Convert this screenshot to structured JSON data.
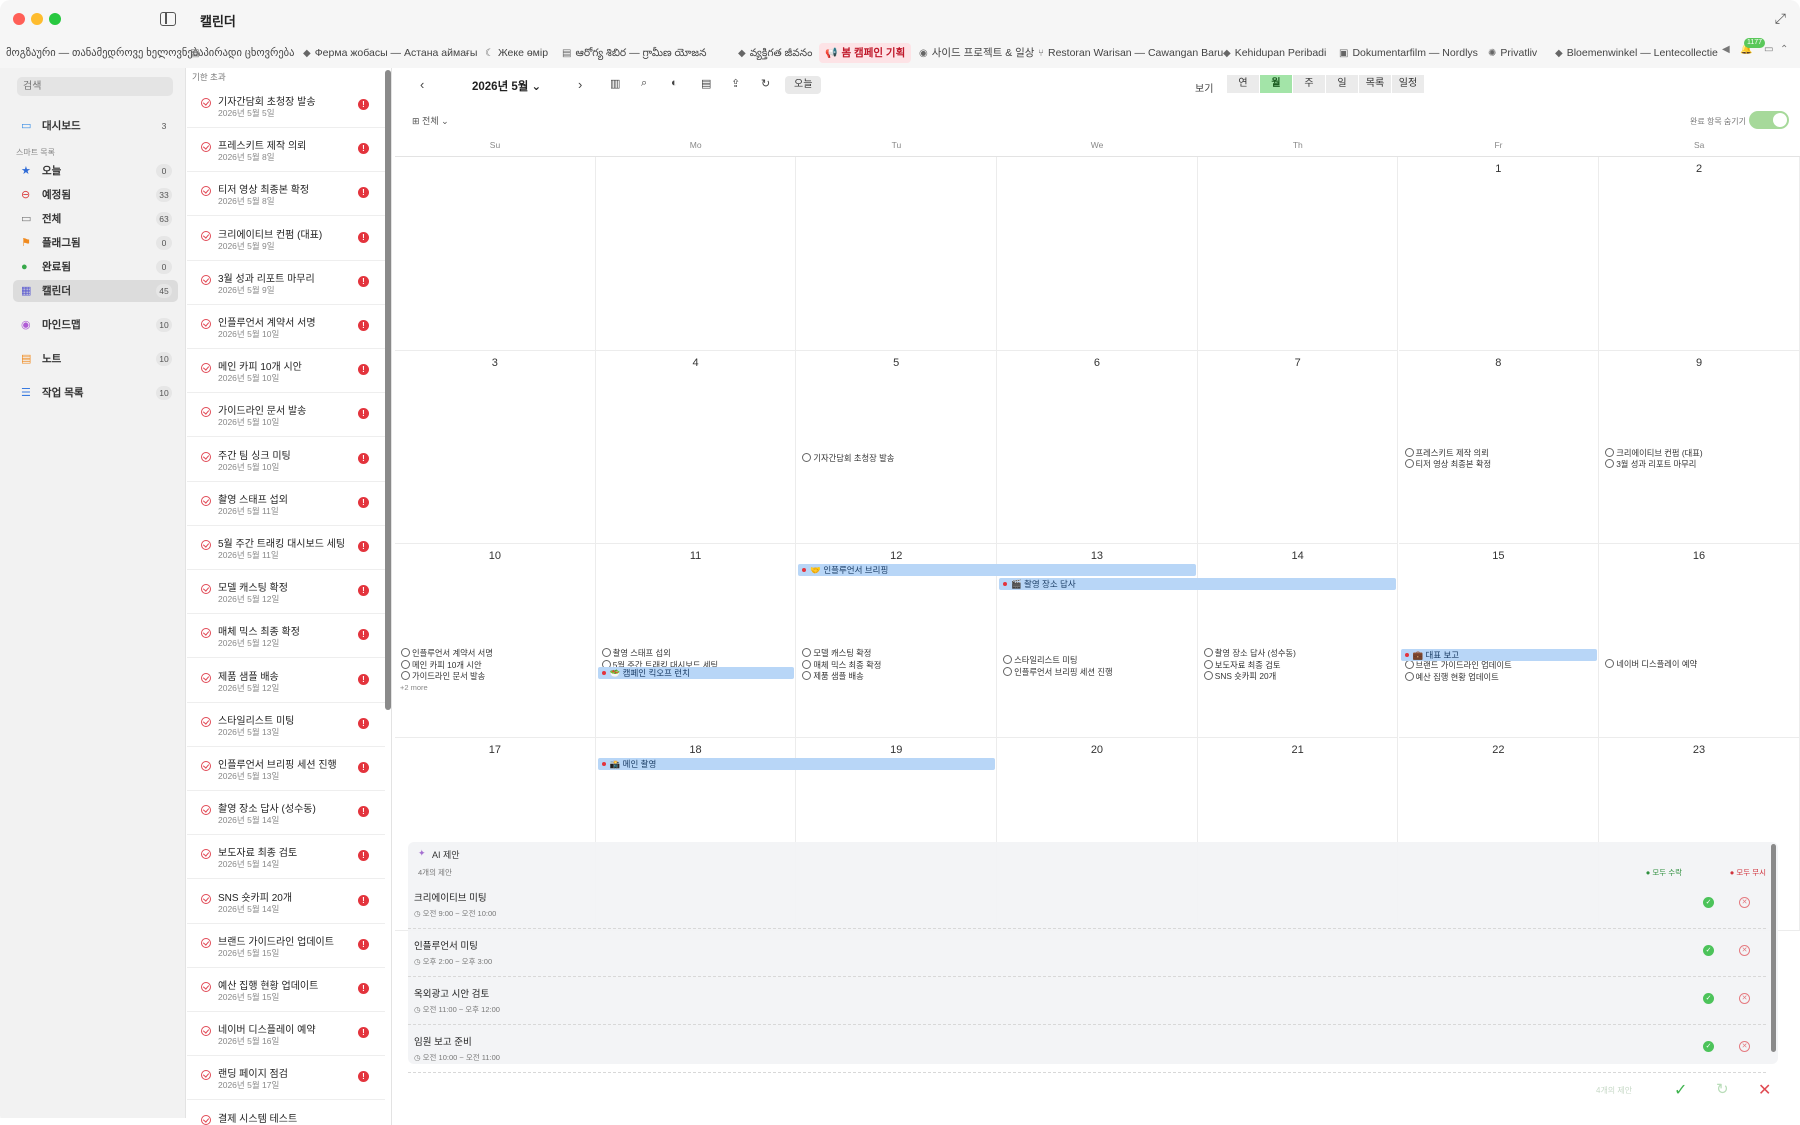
{
  "window": {
    "title": "캘린더"
  },
  "tabs": [
    {
      "label": "მოგზაური — თანამედროვე ხელოვნება",
      "icon": ""
    },
    {
      "label": "პირადი ცხოვრება",
      "icon": "doc-icon"
    },
    {
      "label": "Ферма жобасы — Астана аймағы",
      "icon": "tag-icon"
    },
    {
      "label": "Жеке өмір",
      "icon": "moon-icon"
    },
    {
      "label": "ఆరోగ్య శిబిర — గ్రామీణ యోజన",
      "icon": "doc-icon"
    },
    {
      "label": "వ్యక్తిగత జీవనం",
      "icon": "tag-icon"
    },
    {
      "label": "봄 캠페인 기획",
      "icon": "megaphone-icon"
    },
    {
      "label": "사이드 프로젝트 & 일상",
      "icon": "circle-icon"
    },
    {
      "label": "Restoran Warisan — Cawangan Baru",
      "icon": "fork-icon"
    },
    {
      "label": "Kehidupan Peribadi",
      "icon": "tag-icon"
    },
    {
      "label": "Dokumentarfilm — Nordlys",
      "icon": "camera-icon"
    },
    {
      "label": "Privatliv",
      "icon": "sun-icon"
    },
    {
      "label": "Bloemenwinkel — Lentecollectie",
      "icon": "tag-icon"
    }
  ],
  "tab_controls": {
    "badge": "1177"
  },
  "sidebar": {
    "search_placeholder": "검색",
    "dashboard": {
      "label": "대시보드",
      "count": "3"
    },
    "smart_list_title": "스마트 목록",
    "items": [
      {
        "label": "오늘",
        "count": "0"
      },
      {
        "label": "예정됨",
        "count": "33"
      },
      {
        "label": "전체",
        "count": "63"
      },
      {
        "label": "플래그됨",
        "count": "0"
      },
      {
        "label": "완료됨",
        "count": "0"
      },
      {
        "label": "캘린더",
        "count": "45"
      }
    ],
    "extra": [
      {
        "label": "마인드맵",
        "count": "10"
      },
      {
        "label": "노트",
        "count": "10"
      },
      {
        "label": "작업 목록",
        "count": "10"
      }
    ]
  },
  "tasklist": {
    "header": "기한 초과",
    "items": [
      {
        "title": "기자간담회 초청장 발송",
        "date": "2026년 5월 5일"
      },
      {
        "title": "프레스키트 제작 의뢰",
        "date": "2026년 5월 8일"
      },
      {
        "title": "티저 영상 최종본 확정",
        "date": "2026년 5월 8일"
      },
      {
        "title": "크리에이티브 컨펌 (대표)",
        "date": "2026년 5월 9일"
      },
      {
        "title": "3월 성과 리포트 마무리",
        "date": "2026년 5월 9일"
      },
      {
        "title": "인플루언서 계약서 서명",
        "date": "2026년 5월 10일"
      },
      {
        "title": "메인 카피 10개 시안",
        "date": "2026년 5월 10일"
      },
      {
        "title": "가이드라인 문서 발송",
        "date": "2026년 5월 10일"
      },
      {
        "title": "주간 팀 싱크 미팅",
        "date": "2026년 5월 10일"
      },
      {
        "title": "촬영 스태프 섭외",
        "date": "2026년 5월 11일"
      },
      {
        "title": "5월 주간 트래킹 대시보드 세팅",
        "date": "2026년 5월 11일"
      },
      {
        "title": "모델 캐스팅 확정",
        "date": "2026년 5월 12일"
      },
      {
        "title": "매체 믹스 최종 확정",
        "date": "2026년 5월 12일"
      },
      {
        "title": "제품 샘플 배송",
        "date": "2026년 5월 12일"
      },
      {
        "title": "스타일리스트 미팅",
        "date": "2026년 5월 13일"
      },
      {
        "title": "인플루언서 브리핑 세션 진행",
        "date": "2026년 5월 13일"
      },
      {
        "title": "촬영 장소 답사 (성수동)",
        "date": "2026년 5월 14일"
      },
      {
        "title": "보도자료 최종 검토",
        "date": "2026년 5월 14일"
      },
      {
        "title": "SNS 숏카피 20개",
        "date": "2026년 5월 14일"
      },
      {
        "title": "브랜드 가이드라인 업데이트",
        "date": "2026년 5월 15일"
      },
      {
        "title": "예산 집행 현황 업데이트",
        "date": "2026년 5월 15일"
      },
      {
        "title": "네이버 디스플레이 예약",
        "date": "2026년 5월 16일"
      },
      {
        "title": "랜딩 페이지 점검",
        "date": "2026년 5월 17일"
      },
      {
        "title": "결제 시스템 테스트",
        "date": ""
      }
    ],
    "flag": "!"
  },
  "calendar": {
    "month_title": "2026년 5월",
    "today": "오늘",
    "view_label": "보기",
    "views": [
      "연",
      "월",
      "주",
      "일",
      "목록",
      "일정"
    ],
    "active_view": "월",
    "filter": "전체",
    "hide_done": "완료 항목 숨기기",
    "weekdays": [
      "Su",
      "Mo",
      "Tu",
      "We",
      "Th",
      "Fr",
      "Sa"
    ],
    "weeks": [
      [
        {
          "d": ""
        },
        {
          "d": ""
        },
        {
          "d": ""
        },
        {
          "d": ""
        },
        {
          "d": ""
        },
        {
          "d": "1"
        },
        {
          "d": "2"
        }
      ],
      [
        {
          "d": "3"
        },
        {
          "d": "4"
        },
        {
          "d": "5",
          "ev": [
            "기자간담회 초청장 발송"
          ]
        },
        {
          "d": "6"
        },
        {
          "d": "7"
        },
        {
          "d": "8",
          "ev": [
            "프레스키트 제작 의뢰",
            "티저 영상 최종본 확정"
          ]
        },
        {
          "d": "9",
          "ev": [
            "크리에이티브 컨펌 (대표)",
            "3월 성과 리포트 마무리"
          ]
        }
      ],
      [
        {
          "d": "10",
          "ev": [
            "인플루언서 계약서 서명",
            "메인 카피 10개 시안",
            "가이드라인 문서 발송"
          ],
          "more": "+2 more"
        },
        {
          "d": "11",
          "ev": [
            "촬영 스태프 섭외",
            "5월 주간 트래킹 대시보드 세팅"
          ]
        },
        {
          "d": "12",
          "ev": [
            "모델 캐스팅 확정",
            "매체 믹스 최종 확정",
            "제품 샘플 배송"
          ]
        },
        {
          "d": "13",
          "ev": [
            "스타일리스트 미팅",
            "인플루언서 브리핑 세션 진행"
          ]
        },
        {
          "d": "14",
          "ev": [
            "촬영 장소 답사 (성수동)",
            "보도자료 최종 검토",
            "SNS 숏카피 20개"
          ]
        },
        {
          "d": "15",
          "ev": [
            "브랜드 가이드라인 업데이트",
            "예산 집행 현황 업데이트"
          ]
        },
        {
          "d": "16",
          "ev": [
            "네이버 디스플레이 예약"
          ]
        }
      ],
      [
        {
          "d": "17"
        },
        {
          "d": "18"
        },
        {
          "d": "19"
        },
        {
          "d": "20"
        },
        {
          "d": "21"
        },
        {
          "d": "22"
        },
        {
          "d": "23"
        }
      ]
    ],
    "bars": {
      "influencer_briefing": "🤝 인플루언서 브리핑",
      "location_scout": "🎬 촬영 장소 답사",
      "kickoff_lunch": "🥗 캠페인 킥오프 런치",
      "ceo_report": "💼 대표 보고",
      "main_shoot": "📸 메인 촬영"
    }
  },
  "ai_panel": {
    "title": "AI 제안",
    "subtitle": "4개의 제안",
    "accept_all": "모두 수락",
    "ignore_all": "모두 무시",
    "suggestions": [
      {
        "title": "크리에이티브 미팅",
        "time": "오전 9:00 ~ 오전 10:00"
      },
      {
        "title": "인플루언서 미팅",
        "time": "오후 2:00 ~ 오후 3:00"
      },
      {
        "title": "옥외광고 시안 검토",
        "time": "오전 11:00 ~ 오후 12:00"
      },
      {
        "title": "임원 보고 준비",
        "time": "오전 10:00 ~ 오전 11:00"
      }
    ]
  },
  "bottom": {
    "pending_label": "4개의 제안"
  }
}
